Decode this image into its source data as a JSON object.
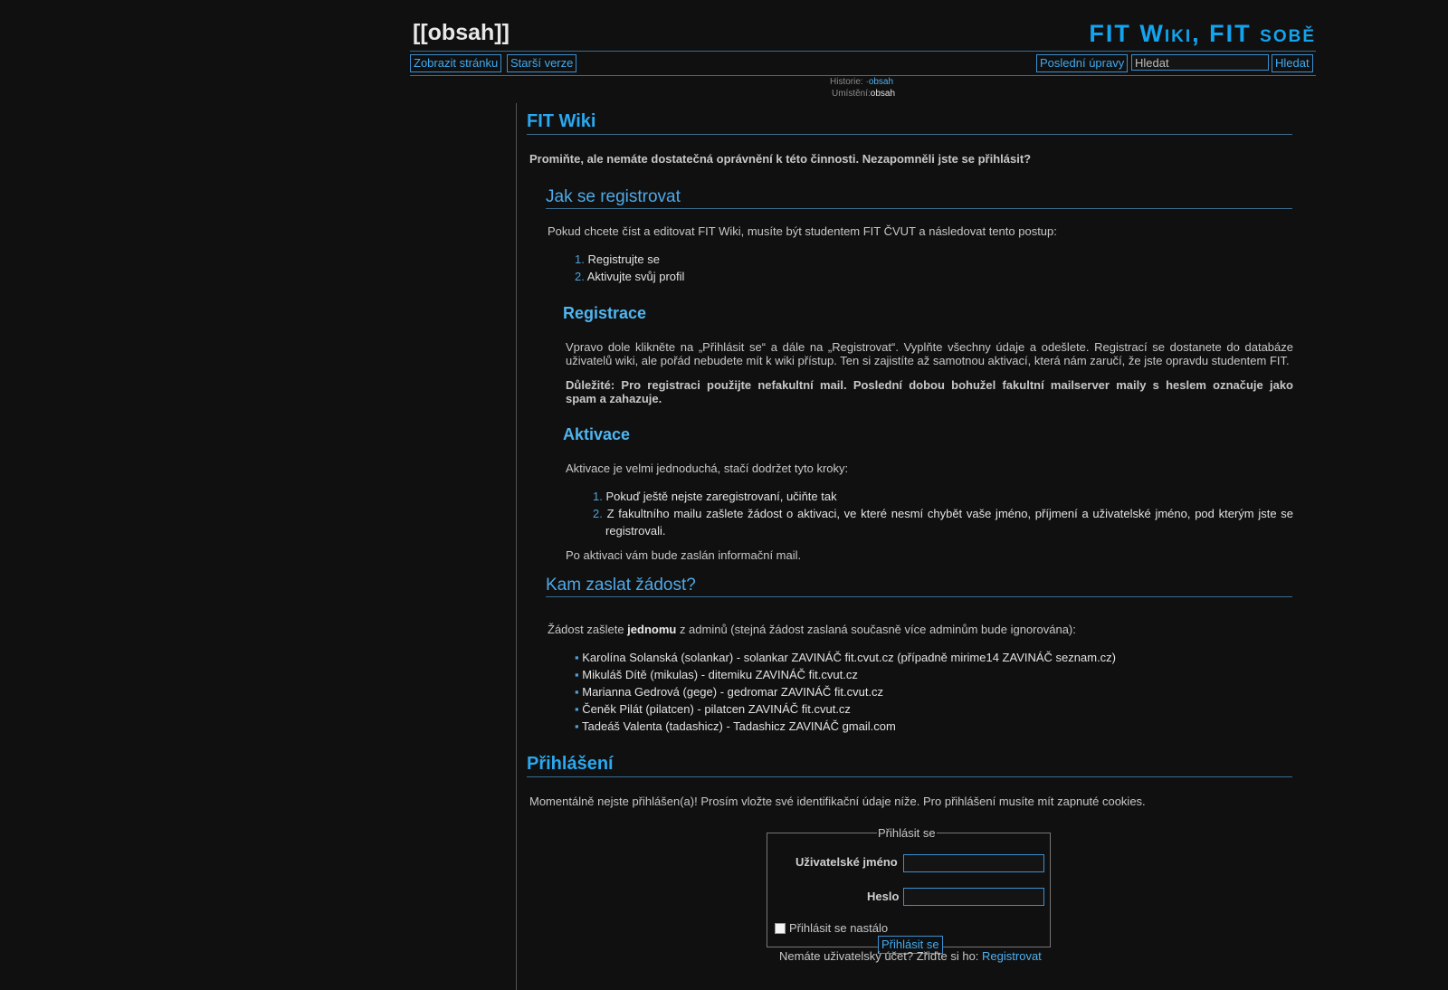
{
  "header": {
    "page_name": "[[obsah]]",
    "wiki_title": "FIT Wiki, FIT sobě"
  },
  "toolbar": {
    "show_page": "Zobrazit stránku",
    "old_revisions": "Starší verze",
    "recent_changes": "Poslední úpravy",
    "search_placeholder": "Hledat",
    "search_button": "Hledat"
  },
  "breadcrumbs": {
    "history_label": "Historie:",
    "history_sep": "·",
    "history_link": "obsah",
    "location_label": "Umístění:",
    "location_value": "obsah"
  },
  "content": {
    "title": "FIT Wiki",
    "denied": "Promiňte, ale nemáte dostatečná oprávnění k této činnosti. Nezapomněli jste se přihlásit?",
    "how_to_register": {
      "heading": "Jak se registrovat",
      "intro": "Pokud chcete číst a editovat FIT Wiki, musíte být studentem FIT ČVUT a následovat tento postup:",
      "steps": [
        "Registrujte se",
        "Aktivujte svůj profil"
      ]
    },
    "registration": {
      "heading": "Registrace",
      "text_line1": "Vpravo dole klikněte na „Přihlásit se“ a dále na „Registrovat“. Vyplňte všechny údaje a odešlete. Registrací se dostanete do databáze",
      "text_line2": "uživatelů wiki, ale pořád nebudete mít k wiki přístup. Ten si zajistíte až samotnou aktivací, která nám zaručí, že jste opravdu studentem FIT.",
      "important_line1": "Důležité: Pro registraci použijte nefakultní mail. Poslední dobou bohužel fakultní mailserver maily s heslem označuje jako",
      "important_line2": "spam a zahazuje."
    },
    "activation": {
      "heading": "Aktivace",
      "intro": "Aktivace je velmi jednoduchá, stačí dodržet tyto kroky:",
      "step1": "Pokuď ještě nejste zaregistrovaní, učiňte tak",
      "step2_line1": "Z fakultního mailu zašlete žádost o aktivaci, ve které nesmí chybět vaše jméno, příjmení a uživatelské jméno, pod kterým jste se",
      "step2_line2": "registrovali.",
      "after": "Po aktivaci vám bude zaslán informační mail."
    },
    "where_to_send": {
      "heading": "Kam zaslat žádost?",
      "intro_pre": "Žádost zašlete ",
      "intro_bold": "jednomu",
      "intro_post": " z adminů (stejná žádost zaslaná současně více adminům bude ignorována):",
      "admins": [
        "Karolína Solanská (solankar) - solankar ZAVINÁČ fit.cvut.cz (případně mirime14 ZAVINÁČ seznam.cz)",
        "Mikuláš Dítě (mikulas) - ditemiku ZAVINÁČ fit.cvut.cz",
        "Marianna Gedrová (gege) - gedromar ZAVINÁČ fit.cvut.cz",
        "Čeněk Pilát (pilatcen) - pilatcen ZAVINÁČ fit.cvut.cz",
        "Tadeáš Valenta (tadashicz) - Tadashicz ZAVINÁČ gmail.com"
      ]
    },
    "login": {
      "heading": "Přihlášení",
      "intro": "Momentálně nejste přihlášen(a)! Prosím vložte své identifikační údaje níže. Pro přihlášení musíte mít zapnuté cookies.",
      "legend": "Přihlásit se",
      "username_label": "Uživatelské jméno",
      "password_label": "Heslo",
      "remember_label": "Přihlásit se nastálo",
      "submit": "Přihlásit se",
      "no_account": "Nemáte uživatelský účet? Zřiďte si ho: ",
      "register_link": "Registrovat"
    }
  }
}
